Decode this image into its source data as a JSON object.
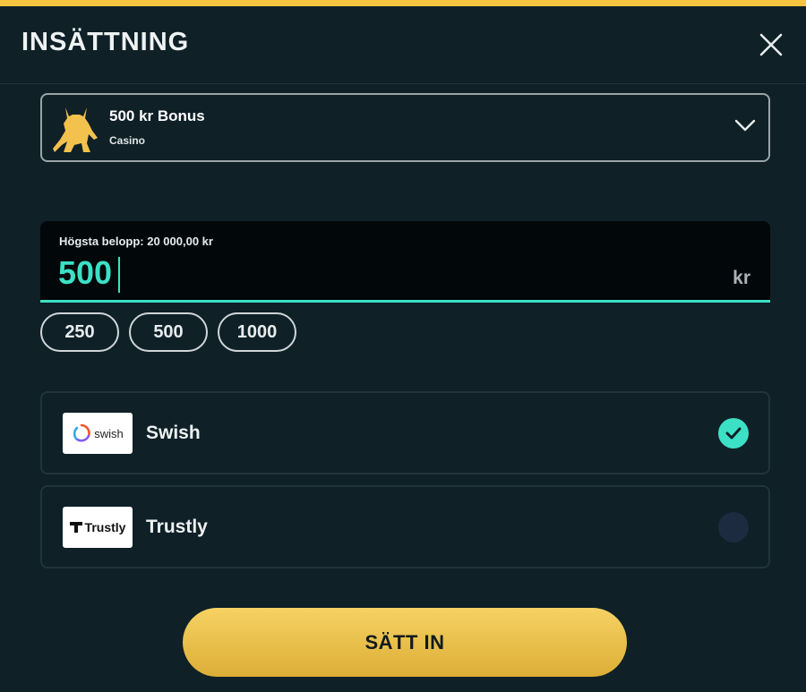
{
  "header": {
    "title": "INSÄTTNING",
    "accent_color": "#f5c542"
  },
  "bonus": {
    "title": "500 kr Bonus",
    "subtitle": "Casino",
    "icon": "bull-icon"
  },
  "amount": {
    "label": "Högsta belopp: 20 000,00 kr",
    "value": "500",
    "currency": "kr",
    "accent_color": "#3ce0c5"
  },
  "quick_amounts": [
    "250",
    "500",
    "1000"
  ],
  "payment_methods": [
    {
      "logo_text": "swish",
      "label": "Swish",
      "selected": true
    },
    {
      "logo_text": "Trustly",
      "label": "Trustly",
      "selected": false
    }
  ],
  "submit": {
    "label": "SÄTT IN"
  }
}
